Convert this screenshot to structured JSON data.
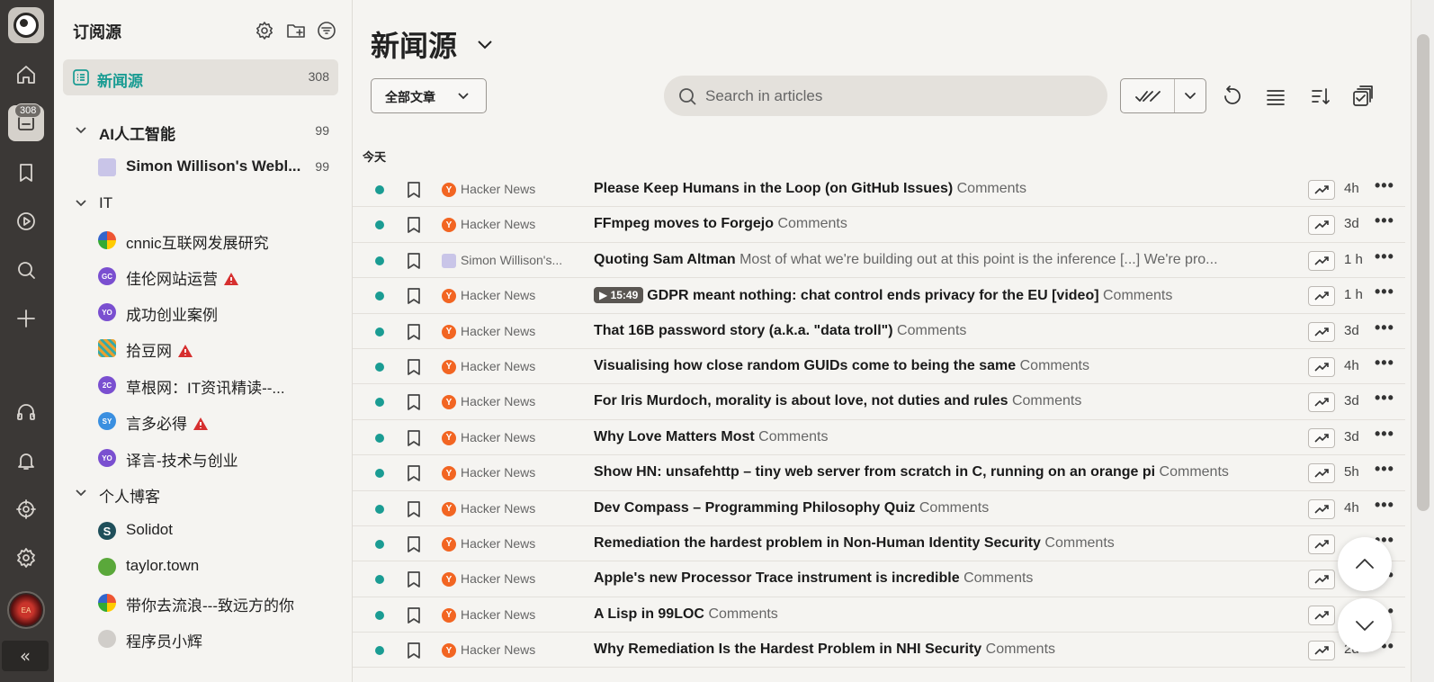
{
  "app": {
    "unread_badge": "308"
  },
  "rail": {
    "items": [
      {
        "icon": "home-icon"
      },
      {
        "icon": "inbox-icon",
        "badge": "308"
      },
      {
        "icon": "bookmark-icon"
      },
      {
        "icon": "play-circle-icon"
      },
      {
        "icon": "search-icon"
      },
      {
        "icon": "plus-icon"
      },
      {
        "icon": "headphones-icon"
      },
      {
        "icon": "bell-icon"
      },
      {
        "icon": "target-icon"
      },
      {
        "icon": "gear-icon"
      }
    ],
    "collapse_label": "«"
  },
  "sidebar": {
    "title": "订阅源",
    "active": {
      "label": "新闻源",
      "count": "308"
    },
    "groups": [
      {
        "name": "AI人工智能",
        "count": "99",
        "feeds": [
          {
            "name": "Simon Willison's Webl...",
            "count": "99",
            "bold": true
          }
        ]
      },
      {
        "name": "IT",
        "count": "",
        "feeds": [
          {
            "name": "cnnic互联网发展研究",
            "warn": false
          },
          {
            "name": "佳伦网站运营",
            "warn": true,
            "avatar_text": "GC",
            "avatar_color": "#7a4fd0"
          },
          {
            "name": "成功创业案例",
            "warn": false,
            "avatar_text": "YO",
            "avatar_color": "#7a4fd0"
          },
          {
            "name": "拾豆网",
            "warn": true
          },
          {
            "name": "草根网：IT资讯精读--...",
            "warn": false,
            "avatar_text": "2C",
            "avatar_color": "#7a4fd0"
          },
          {
            "name": "言多必得",
            "warn": true,
            "avatar_text": "SY",
            "avatar_color": "#3a8fe0"
          },
          {
            "name": "译言-技术与创业",
            "warn": false,
            "avatar_text": "YO",
            "avatar_color": "#7a4fd0"
          }
        ]
      },
      {
        "name": "个人博客",
        "count": "",
        "feeds": [
          {
            "name": "Solidot"
          },
          {
            "name": "taylor.town"
          },
          {
            "name": "带你去流浪---致远方的你"
          },
          {
            "name": "程序员小辉"
          }
        ]
      }
    ]
  },
  "main": {
    "title": "新闻源",
    "filter_label": "全部文章",
    "search_placeholder": "Search in articles",
    "section_label": "今天",
    "articles": [
      {
        "source": "Hacker News",
        "title": "Please Keep Humans in the Loop (on GitHub Issues)",
        "sub": "Comments",
        "age": "4h"
      },
      {
        "source": "Hacker News",
        "title": "FFmpeg moves to Forgejo",
        "sub": "Comments",
        "age": "3d"
      },
      {
        "source": "Simon Willison's...",
        "title": "Quoting Sam Altman",
        "sub": "Most of what we're building out at this point is the inference [...] We're pro...",
        "age": "1 h",
        "sw": true
      },
      {
        "source": "Hacker News",
        "video": "15:49",
        "title": "GDPR meant nothing: chat control ends privacy for the EU [video]",
        "sub": "Comments",
        "age": "1 h"
      },
      {
        "source": "Hacker News",
        "title": "That 16B password story (a.k.a. \"data troll\")",
        "sub": "Comments",
        "age": "3d"
      },
      {
        "source": "Hacker News",
        "title": "Visualising how close random GUIDs come to being the same",
        "sub": "Comments",
        "age": "4h"
      },
      {
        "source": "Hacker News",
        "title": "For Iris Murdoch, morality is about love, not duties and rules",
        "sub": "Comments",
        "age": "3d"
      },
      {
        "source": "Hacker News",
        "title": "Why Love Matters Most",
        "sub": "Comments",
        "age": "3d"
      },
      {
        "source": "Hacker News",
        "title": "Show HN: unsafehttp – tiny web server from scratch in C, running on an orange pi",
        "sub": "Comments",
        "age": "5h"
      },
      {
        "source": "Hacker News",
        "title": "Dev Compass – Programming Philosophy Quiz",
        "sub": "Comments",
        "age": "4h"
      },
      {
        "source": "Hacker News",
        "title": "Remediation the hardest problem in Non-Human Identity Security",
        "sub": "Comments",
        "age": ""
      },
      {
        "source": "Hacker News",
        "title": "Apple's new Processor Trace instrument is incredible",
        "sub": "Comments",
        "age": ""
      },
      {
        "source": "Hacker News",
        "title": "A Lisp in 99LOC",
        "sub": "Comments",
        "age": ""
      },
      {
        "source": "Hacker News",
        "title": "Why Remediation Is the Hardest Problem in NHI Security",
        "sub": "Comments",
        "age": "2d"
      }
    ]
  },
  "colors": {
    "accent": "#1a9c93",
    "rail": "#3b3836",
    "hn": "#f26522",
    "warn": "#d62f2f"
  }
}
